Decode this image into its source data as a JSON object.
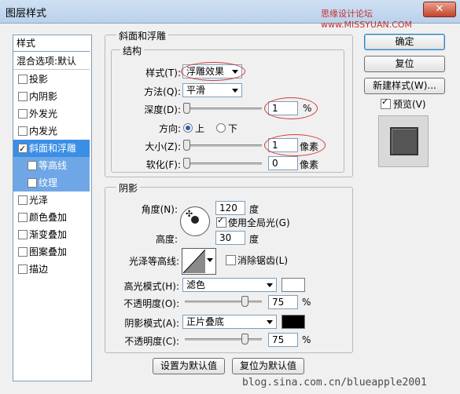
{
  "window": {
    "title": "图层样式",
    "watermark": "思缘设计论坛 www.MISSYUAN.COM",
    "close": "✕"
  },
  "sidebar": {
    "header": "样式",
    "blend_options": "混合选项:默认",
    "items": [
      {
        "label": "投影",
        "checked": false
      },
      {
        "label": "内阴影",
        "checked": false
      },
      {
        "label": "外发光",
        "checked": false
      },
      {
        "label": "内发光",
        "checked": false
      },
      {
        "label": "斜面和浮雕",
        "checked": true
      },
      {
        "label": "等高线",
        "checked": false
      },
      {
        "label": "纹理",
        "checked": false
      },
      {
        "label": "光泽",
        "checked": false
      },
      {
        "label": "颜色叠加",
        "checked": false
      },
      {
        "label": "渐变叠加",
        "checked": false
      },
      {
        "label": "图案叠加",
        "checked": false
      },
      {
        "label": "描边",
        "checked": false
      }
    ]
  },
  "bevel": {
    "group_title": "斜面和浮雕",
    "structure_title": "结构",
    "style_label": "样式(T):",
    "style_value": "浮雕效果",
    "technique_label": "方法(Q):",
    "technique_value": "平滑",
    "depth_label": "深度(D):",
    "depth_value": "1",
    "depth_unit": "%",
    "depth_level": 0.0,
    "direction_label": "方向:",
    "direction_up": "上",
    "direction_down": "下",
    "size_label": "大小(Z):",
    "size_value": "1",
    "size_unit": "像素",
    "size_level": 0.0,
    "soften_label": "软化(F):",
    "soften_value": "0",
    "soften_unit": "像素",
    "soften_level": 0.0
  },
  "shading": {
    "title": "阴影",
    "angle_label": "角度(N):",
    "angle_value": "120",
    "angle_unit": "度",
    "global_light_label": "使用全局光(G)",
    "global_light": true,
    "altitude_label": "高度:",
    "altitude_value": "30",
    "altitude_unit": "度",
    "gloss_contour_label": "光泽等高线:",
    "anti_alias_label": "消除锯齿(L)",
    "anti_alias": false,
    "highlight_mode_label": "高光模式(H):",
    "highlight_mode_value": "滤色",
    "highlight_color": "#ffffff",
    "highlight_opacity_label": "不透明度(O):",
    "highlight_opacity_value": "75",
    "highlight_opacity_unit": "%",
    "highlight_opacity_level": 0.75,
    "shadow_mode_label": "阴影模式(A):",
    "shadow_mode_value": "正片叠底",
    "shadow_color": "#000000",
    "shadow_opacity_label": "不透明度(C):",
    "shadow_opacity_value": "75",
    "shadow_opacity_unit": "%",
    "shadow_opacity_level": 0.75
  },
  "buttons": {
    "ok": "确定",
    "reset": "复位",
    "new_style": "新建样式(W)...",
    "preview_label": "预览(V)",
    "preview": true,
    "make_default": "设置为默认值",
    "reset_default": "复位为默认值"
  },
  "footer": {
    "watermark": "blog.sina.com.cn/blueapple2001"
  },
  "colors": {
    "selection": "#3a8ee6",
    "annotation": "#d23a3a"
  }
}
